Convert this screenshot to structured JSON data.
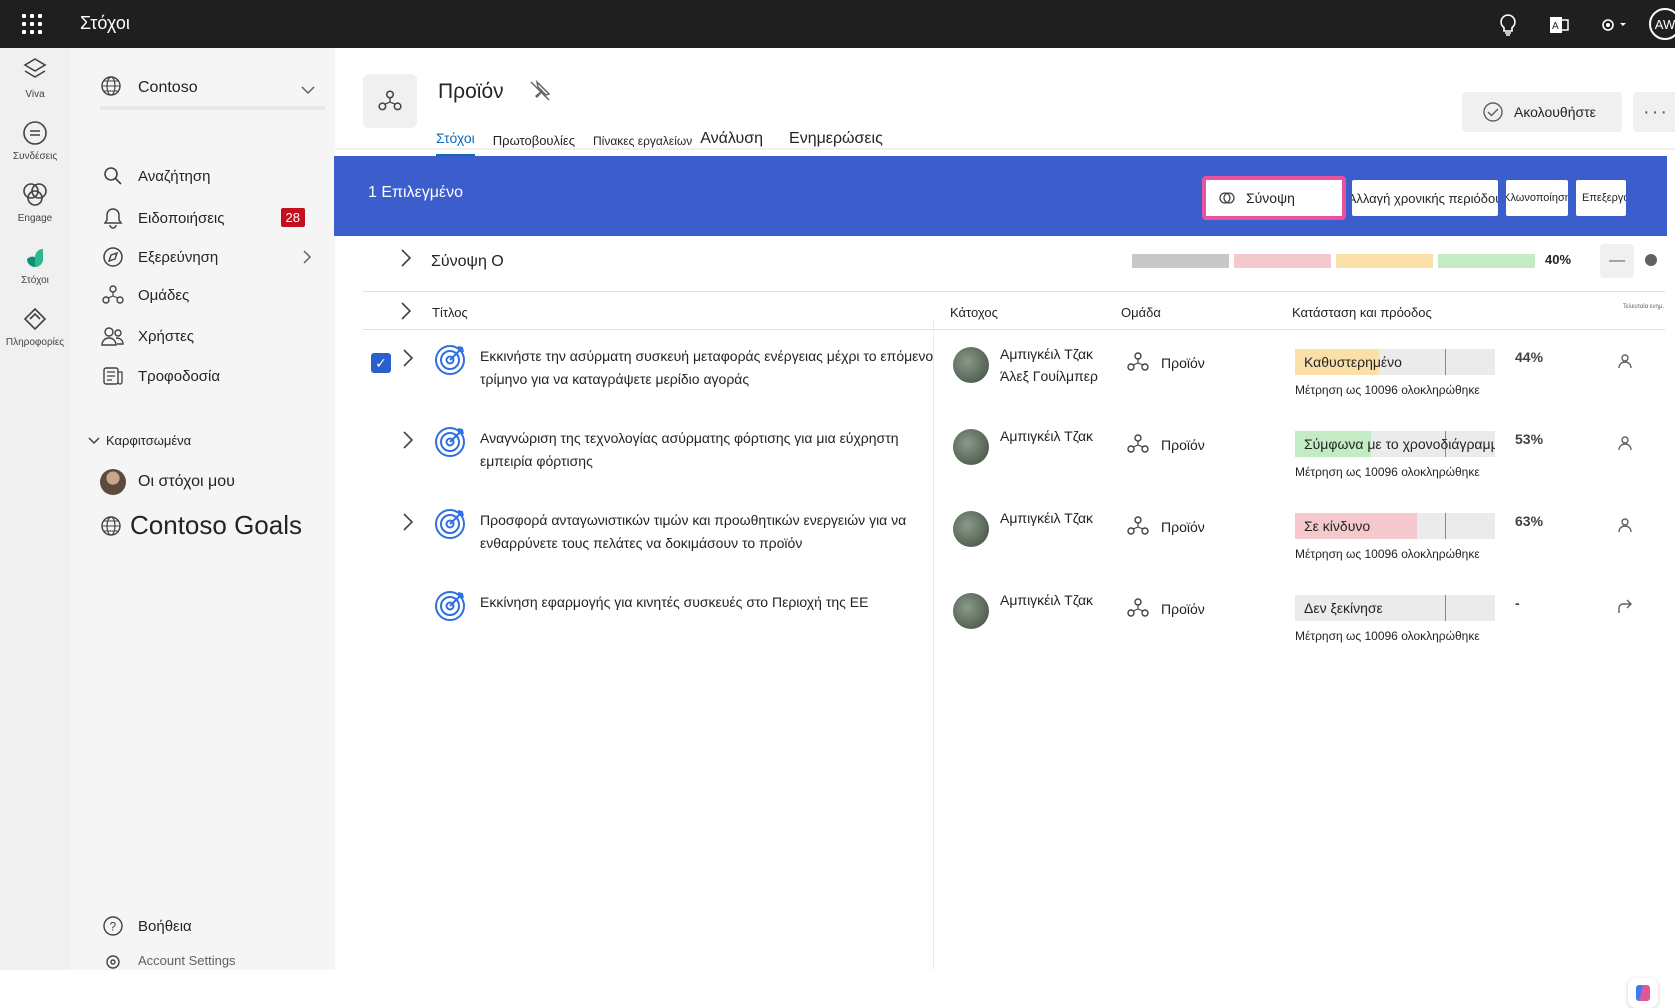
{
  "topbar": {
    "app_title": "Στόχοι",
    "avatar_initials": "AW",
    "icons": [
      "lightbulb-icon",
      "office-icon",
      "settings-icon"
    ]
  },
  "rail": {
    "items": [
      {
        "label": "Viva",
        "icon": "viva-icon"
      },
      {
        "label": "Συνδέσεις",
        "icon": "connections-icon"
      },
      {
        "label": "Engage",
        "icon": "engage-icon"
      },
      {
        "label": "Στόχοι",
        "icon": "goals-icon"
      },
      {
        "label": "Πληροφορίες",
        "icon": "insights-icon"
      }
    ]
  },
  "nav": {
    "org": "Contoso",
    "items": [
      {
        "label": "Αναζήτηση",
        "icon": "search-icon"
      },
      {
        "label": "Ειδοποιήσεις",
        "icon": "bell-icon",
        "badge": "28"
      },
      {
        "label": "Εξερεύνηση",
        "icon": "compass-icon"
      },
      {
        "label": "Ομάδες",
        "icon": "teams-icon"
      },
      {
        "label": "Χρήστες",
        "icon": "people-icon"
      },
      {
        "label": "Τροφοδοσία",
        "icon": "feed-icon"
      }
    ],
    "pinned_header": "Καρφιτσωμένα",
    "pinned": [
      {
        "label": "Οι στόχοι μου"
      },
      {
        "label": "Contoso Goals"
      }
    ],
    "help": "Βοήθεια",
    "account_settings": "Account Settings"
  },
  "header": {
    "title": "Προϊόν",
    "tabs": [
      "Στόχοι",
      "Πρωτοβουλίες",
      "Πίνακες εργαλείων",
      "Ανάλυση",
      "Ενημερώσεις"
    ],
    "follow_label": "Ακολουθήστε",
    "more_label": "···"
  },
  "selection": {
    "count_text": "1 Επιλεγμένο",
    "summary_btn": "Σύνοψη",
    "change_period_btn": "Αλλαγή χρονικής περιόδου",
    "clone_btn": "Κλωνοποίηση",
    "edit_btn": "Επεξεργασία"
  },
  "summary_row": {
    "title": "Σύνοψη Ο",
    "percent": "40%",
    "segment_colors": [
      "#c8c8c8",
      "#f4c8cc",
      "#fae0a8",
      "#c4ecc4"
    ]
  },
  "table": {
    "headers": {
      "title": "Τίτλος",
      "owner": "Κάτοχος",
      "team": "Ομάδα",
      "status": "Κατάσταση και πρόοδος",
      "extra": "Τελευταία ενημ."
    },
    "rows": [
      {
        "title": "Εκκινήστε την ασύρματη συσκευή μεταφοράς ενέργειας μέχρι το επόμενο τρίμηνο για να καταγράψετε μερίδιο αγοράς",
        "owner": "Αμπιγκέιλ Τζακ",
        "owner2": "Άλεξ Γουίλμπερ",
        "team": "Προϊόν",
        "status": "Καθυστερημένο",
        "status_color": "#fae0a8",
        "progress": 0.44,
        "percent": "44%",
        "measure": "Μέτρηση ως 10096 ολοκληρώθηκε",
        "selected": true,
        "expandable": true
      },
      {
        "title": "Αναγνώριση της τεχνολογίας ασύρματης φόρτισης για μια εύχρηστη εμπειρία φόρτισης",
        "owner": "Αμπιγκέιλ Τζακ",
        "owner2": "",
        "team": "Προϊόν",
        "status": "Σύμφωνα με το χρονοδιάγραμμα",
        "status_color": "#c4ecc4",
        "progress": 0.53,
        "percent": "53%",
        "measure": "Μέτρηση ως 10096 ολοκληρώθηκε",
        "selected": false,
        "expandable": true
      },
      {
        "title": "Προσφορά ανταγωνιστικών τιμών και προωθητικών ενεργειών για να ενθαρρύνετε τους πελάτες να δοκιμάσουν το προϊόν",
        "owner": "Αμπιγκέιλ Τζακ",
        "owner2": "",
        "team": "Προϊόν",
        "status": "Σε κίνδυνο",
        "status_color": "#f4c8cc",
        "progress": 0.63,
        "percent": "63%",
        "measure": "Μέτρηση ως 10096 ολοκληρώθηκε",
        "selected": false,
        "expandable": true
      },
      {
        "title": "Εκκίνηση εφαρμογής για κινητές συσκευές στο Περιοχή της ΕΕ",
        "owner": "Αμπιγκέιλ Τζακ",
        "owner2": "",
        "team": "Προϊόν",
        "status": "Δεν ξεκίνησε",
        "status_color": "#ebebeb",
        "progress": 0,
        "percent": "-",
        "measure": "Μέτρηση ως 10096 ολοκληρώθηκε",
        "selected": false,
        "expandable": false
      }
    ]
  },
  "accent": "#3b5ecc"
}
